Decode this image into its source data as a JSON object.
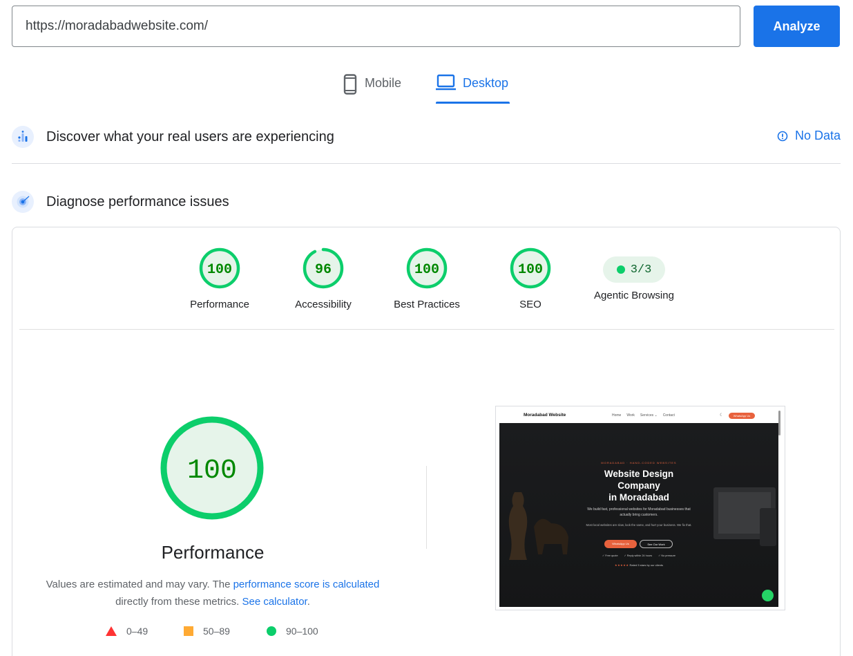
{
  "url_bar": {
    "value": "https://moradabadwebsite.com/",
    "analyze_label": "Analyze"
  },
  "tabs": [
    {
      "label": "Mobile",
      "icon": "smartphone-icon",
      "selected": false
    },
    {
      "label": "Desktop",
      "icon": "laptop-icon",
      "selected": true
    }
  ],
  "field_data": {
    "title": "Discover what your real users are experiencing",
    "status": "No Data",
    "icon": "crux-chart-icon"
  },
  "lab_data": {
    "title": "Diagnose performance issues",
    "icon": "lighthouse-icon"
  },
  "scores": [
    {
      "label": "Performance",
      "score": "100",
      "value": 100
    },
    {
      "label": "Accessibility",
      "score": "96",
      "value": 96
    },
    {
      "label": "Best Practices",
      "score": "100",
      "value": 100
    },
    {
      "label": "SEO",
      "score": "100",
      "value": 100
    }
  ],
  "agentic": {
    "label": "Agentic Browsing",
    "value": "3/3"
  },
  "performance": {
    "score": "100",
    "value": 100,
    "title": "Performance",
    "explain_prefix": "Values are estimated and may vary. The ",
    "explain_link": "performance score is calculated",
    "explain_middle": " directly from these metrics. ",
    "calculator_link": "See calculator",
    "explain_suffix": "."
  },
  "legend": [
    {
      "range": "0–49",
      "shape": "triangle",
      "color": "#ff3333"
    },
    {
      "range": "50–89",
      "shape": "square",
      "color": "#ffaa33"
    },
    {
      "range": "90–100",
      "shape": "circle",
      "color": "#0cce6b"
    }
  ],
  "colors": {
    "accent": "#1a73e8",
    "pass": "#0cce6b",
    "pass_text": "#008800",
    "pass_bg": "#e6f4ea"
  },
  "thumbnail": {
    "brand": "Moradabad Website",
    "nav_links": [
      "Home",
      "Work",
      "Services ⌄",
      "Contact"
    ],
    "nav_cta": "WhatsApp Us",
    "kicker": "MORADABAD · HAND-CODED WEBSITES",
    "title_line1": "Website Design",
    "title_line2": "Company",
    "title_line3": "in Moradabad",
    "sub": "We build fast, professional websites for Moradabad businesses that actually bring customers.",
    "sub2": "Most local websites are slow, look the same, and hurt your business. We fix that.",
    "btn_primary": "WhatsApp Us",
    "btn_secondary": "See Our Work",
    "checks": [
      "✓ Free quote",
      "✓ Reply within 24 hours",
      "✓ No pressure"
    ],
    "stars": "★★★★★",
    "rating": "Rated 5 stars by our clients"
  }
}
